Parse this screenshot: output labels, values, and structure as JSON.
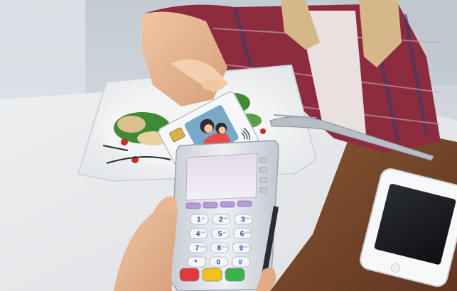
{
  "photo": {
    "subject": "contactless card payment at a restaurant table",
    "colors": {
      "wall": "#cfd6dc",
      "tablecloth": "#e9eaec",
      "wood_table": "#7a4a2c",
      "plaid_shirt": "#8e2c3f",
      "hair": "#d6b78a",
      "skin": "#e9b893",
      "terminal_body": "#dde2e8",
      "terminal_screen": "#ece6f2",
      "function_keys": "#b99ad8",
      "key_labels": "#2a4f9a"
    }
  },
  "card": {
    "icon": "contactless-icon"
  },
  "terminal": {
    "keys": [
      {
        "label": "1",
        "sub": "QZ"
      },
      {
        "label": "2",
        "sub": "ABC"
      },
      {
        "label": "3",
        "sub": "DEF"
      },
      {
        "label": "4",
        "sub": "GHI"
      },
      {
        "label": "5",
        "sub": "JKL"
      },
      {
        "label": "6",
        "sub": "MNO"
      },
      {
        "label": "7",
        "sub": "PRS"
      },
      {
        "label": "8",
        "sub": "TUV"
      },
      {
        "label": "9",
        "sub": "WXY"
      },
      {
        "label": "*",
        "sub": ""
      },
      {
        "label": "0",
        "sub": ""
      },
      {
        "label": "#",
        "sub": ""
      }
    ],
    "action_keys": [
      {
        "name": "cancel",
        "color": "#e23a3a"
      },
      {
        "name": "correction",
        "color": "#f2c21a"
      },
      {
        "name": "enter",
        "color": "#3bb24a"
      }
    ]
  },
  "phone": {
    "state": "screen off"
  }
}
